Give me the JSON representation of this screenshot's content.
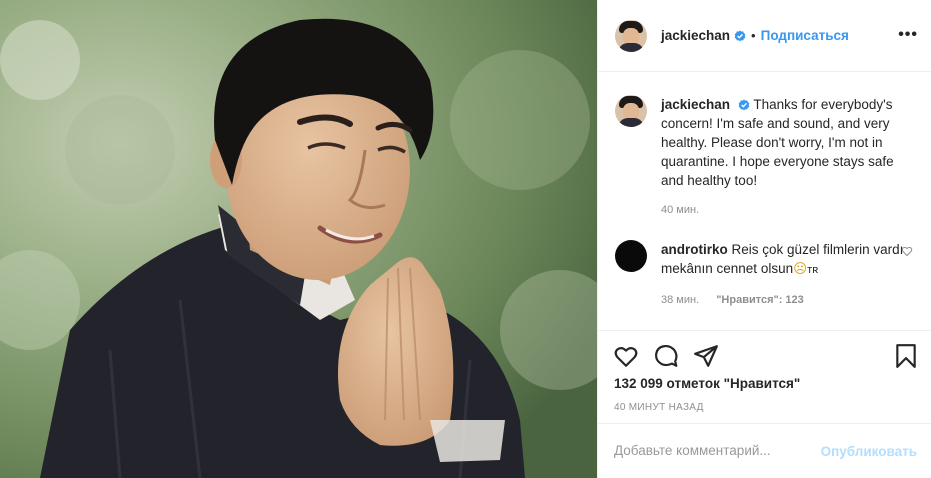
{
  "post": {
    "image_alt": "Фото",
    "author": "jackiechan",
    "separator": "•",
    "follow_label": "Подписаться",
    "more_icon": "more-options-icon",
    "more_label": "•••"
  },
  "caption": {
    "author": "jackiechan",
    "text": "Thanks for everybody's concern! I'm safe and sound, and very healthy. Please don't worry, I'm not in quarantine. I hope everyone stays safe and healthy too!",
    "time": "40 мин."
  },
  "comments": [
    {
      "author": "androtirko",
      "text": "Reis çok güzel filmlerin vardı mekânın cennet olsun",
      "emoji": "☹",
      "flag": "ᴛʀ",
      "time": "38 мин.",
      "likes": "\"Нравится\": 123"
    }
  ],
  "actions": {
    "like_icon": "heart-icon",
    "comment_icon": "comment-icon",
    "share_icon": "share-icon",
    "save_icon": "bookmark-icon"
  },
  "likes_text": "132 099 отметок \"Нравится\"",
  "posted_ago": "40 МИНУТ НАЗАД",
  "add_comment": {
    "placeholder": "Добавьте комментарий...",
    "publish_label": "Опубликовать"
  },
  "colors": {
    "accent": "#3897f0",
    "publish_disabled": "#b2dffc",
    "muted": "#8e8e8e",
    "text": "#262626"
  }
}
